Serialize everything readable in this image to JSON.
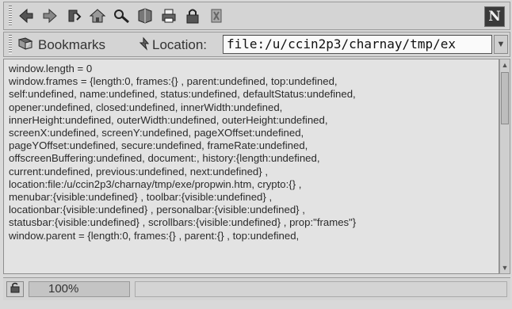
{
  "toolbar": {
    "icons": [
      "back-icon",
      "forward-icon",
      "reload-icon",
      "home-icon",
      "search-icon",
      "guide-icon",
      "print-icon",
      "security-icon",
      "stop-icon"
    ],
    "brand_letter": "N"
  },
  "location_bar": {
    "bookmarks_label": "Bookmarks",
    "location_label": "Location:",
    "url": "file:/u/ccin2p3/charnay/tmp/ex"
  },
  "content": {
    "lines": [
      "window.length = 0",
      "window.frames = {length:0, frames:{} , parent:undefined, top:undefined,",
      "self:undefined, name:undefined, status:undefined, defaultStatus:undefined,",
      "opener:undefined, closed:undefined, innerWidth:undefined,",
      "innerHeight:undefined, outerWidth:undefined, outerHeight:undefined,",
      "screenX:undefined, screenY:undefined, pageXOffset:undefined,",
      "pageYOffset:undefined, secure:undefined, frameRate:undefined,",
      "offscreenBuffering:undefined, document:, history:{length:undefined,",
      "current:undefined, previous:undefined, next:undefined} ,",
      "location:file:/u/ccin2p3/charnay/tmp/exe/propwin.htm, crypto:{} ,",
      "menubar:{visible:undefined} , toolbar:{visible:undefined} ,",
      "locationbar:{visible:undefined} , personalbar:{visible:undefined} ,",
      "statusbar:{visible:undefined} , scrollbars:{visible:undefined} , prop:\"frames\"}",
      "window.parent = {length:0, frames:{} , parent:{} , top:undefined,"
    ]
  },
  "status_bar": {
    "progress_text": "100%",
    "progress_value": 1.0
  }
}
